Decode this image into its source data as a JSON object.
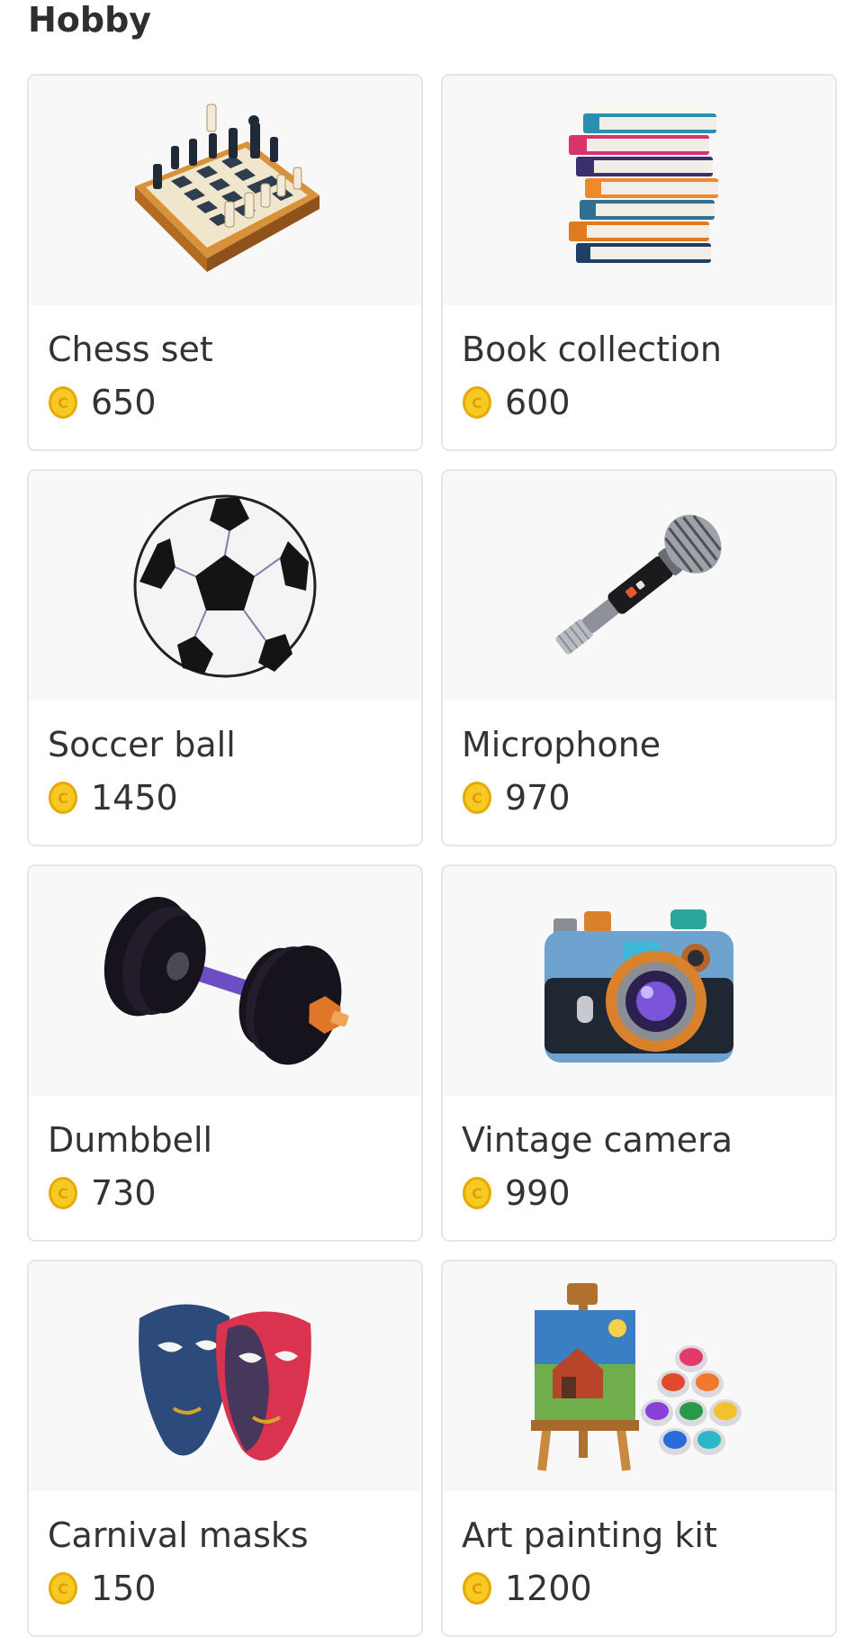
{
  "section": {
    "title": "Hobby"
  },
  "items": [
    {
      "name": "Chess set",
      "price": "650",
      "icon": "chess-set-icon"
    },
    {
      "name": "Book collection",
      "price": "600",
      "icon": "book-stack-icon"
    },
    {
      "name": "Soccer ball",
      "price": "1450",
      "icon": "soccer-ball-icon"
    },
    {
      "name": "Microphone",
      "price": "970",
      "icon": "microphone-icon"
    },
    {
      "name": "Dumbbell",
      "price": "730",
      "icon": "dumbbell-icon"
    },
    {
      "name": "Vintage camera",
      "price": "990",
      "icon": "vintage-camera-icon"
    },
    {
      "name": "Carnival masks",
      "price": "150",
      "icon": "carnival-masks-icon"
    },
    {
      "name": "Art painting kit",
      "price": "1200",
      "icon": "art-painting-kit-icon"
    }
  ],
  "colors": {
    "coin": "#f5c518",
    "card_border": "#e6e6e6",
    "image_background": "#f8f8f9",
    "text": "#333333"
  }
}
